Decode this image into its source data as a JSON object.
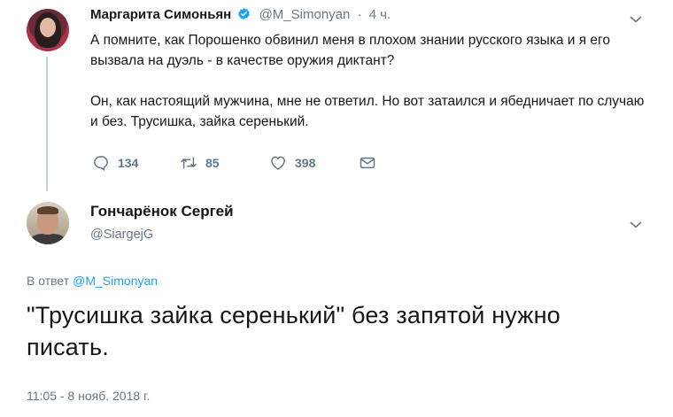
{
  "parent_tweet": {
    "author_name": "Маргарита Симоньян",
    "handle": "@M_Simonyan",
    "separator": "·",
    "time": "4 ч.",
    "paragraphs": [
      "А помните, как Порошенко обвинил меня в плохом знании русского языка и я его вызвала на дуэль - в качестве оружия диктант?",
      "Он, как настоящий мужчина, мне не ответил. Но вот затаился и ябедничает по случаю и без. Трусишка, зайка серенький."
    ],
    "actions": {
      "reply_count": "134",
      "retweet_count": "85",
      "like_count": "398"
    }
  },
  "main_tweet": {
    "author_name": "Гончарёнок Сергей",
    "handle": "@SiargejG",
    "reply_prefix": "В ответ",
    "reply_to": "@M_Simonyan",
    "text": "\"Трусишка зайка серенький\" без запятой нужно писать.",
    "timestamp": "11:05 - 8 нояб. 2018 г."
  },
  "colors": {
    "link": "#1da1f2",
    "muted": "#657786",
    "text": "#14171a",
    "thread_line": "#c4cfd6"
  },
  "icons": [
    "verified-badge-icon",
    "chevron-down-icon",
    "reply-icon",
    "retweet-icon",
    "like-icon",
    "direct-message-icon"
  ]
}
